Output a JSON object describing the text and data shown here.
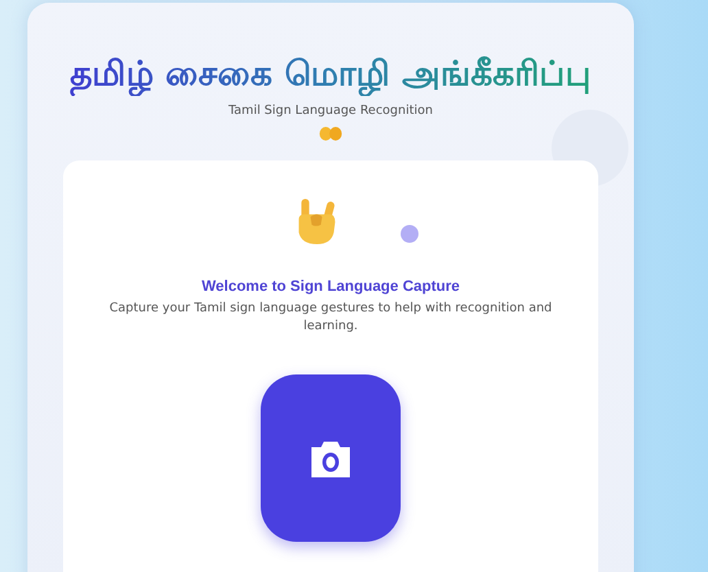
{
  "header": {
    "title": "தமிழ் சைகை மொழி அங்கீகரிப்பு",
    "subtitle": "Tamil Sign Language Recognition"
  },
  "capture": {
    "heading": "Welcome to Sign Language Capture",
    "description": "Capture your Tamil sign language gestures to help with recognition and learning."
  }
}
